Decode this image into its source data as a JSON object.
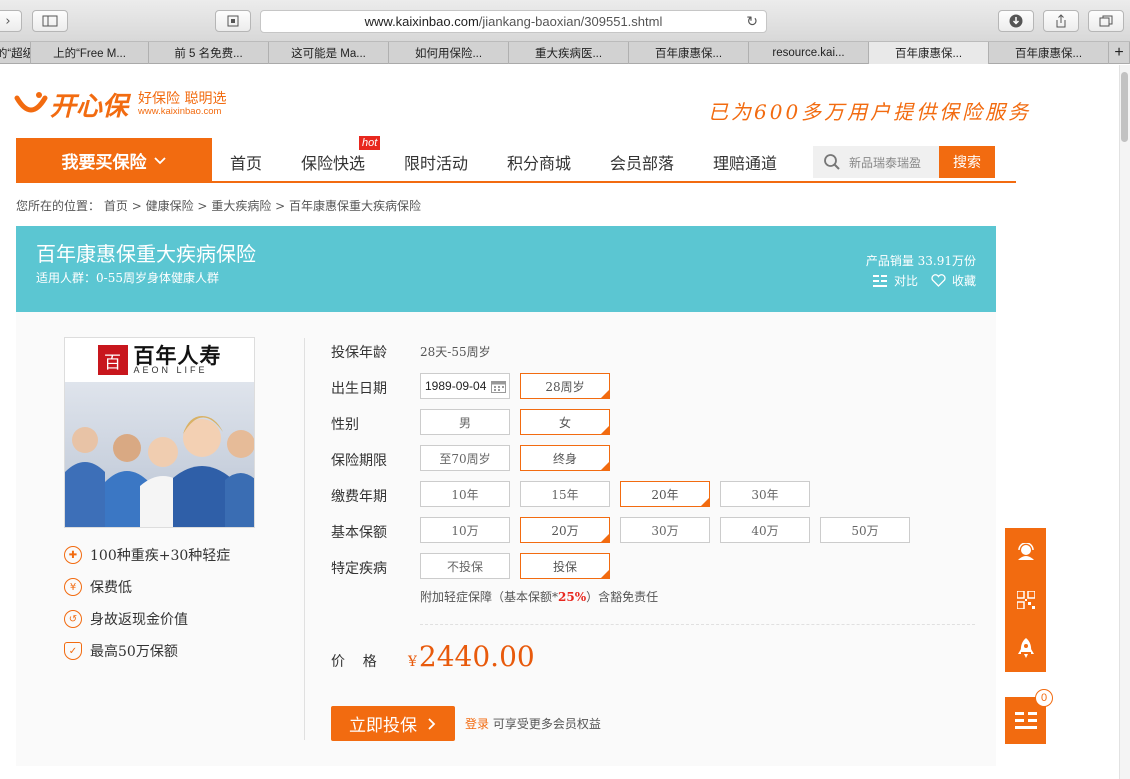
{
  "browser": {
    "url_domain": "www.kaixinbao.com",
    "url_path": "/jiankang-baoxian/309551.shtml",
    "tabs": [
      "的“超级",
      "上的“Free M...",
      "前 5 名免费...",
      "这可能是 Ma...",
      "如何用保险...",
      "重大疾病医...",
      "百年康惠保...",
      "resource.kai...",
      "百年康惠保...",
      "百年康惠保..."
    ],
    "active_tab_index": 8
  },
  "header": {
    "logo_text": "开心保",
    "logo_tagline1": "好保险 聪明选",
    "logo_tagline2": "www.kaixinbao.com",
    "slogan": "已为600多万用户提供保险服务"
  },
  "nav": {
    "buy_button": "我要买保险",
    "items": [
      "首页",
      "保险快选",
      "限时活动",
      "积分商城",
      "会员部落",
      "理赔通道"
    ],
    "hot_badge": "hot",
    "search_placeholder": "新品瑞泰瑞盈",
    "search_button": "搜索"
  },
  "breadcrumb": {
    "prefix": "您所在的位置：",
    "items": [
      "首页",
      "健康保险",
      "重大疾病险",
      "百年康惠保重大疾病保险"
    ],
    "separator": ">"
  },
  "banner": {
    "title": "百年康惠保重大疾病保险",
    "subtitle": "适用人群：0-55周岁身体健康人群",
    "sales": "产品销量 33.91万份",
    "compare": "对比",
    "favorite": "收藏"
  },
  "product": {
    "brand_cn": "百年人寿",
    "brand_en": "AEON LIFE",
    "features": [
      {
        "icon": "plus-icon",
        "text": "100种重疾+30种轻症"
      },
      {
        "icon": "yen-icon",
        "text": "保费低"
      },
      {
        "icon": "refund-icon",
        "text": "身故返现金价值"
      },
      {
        "icon": "shield-icon",
        "text": "最高50万保额"
      }
    ]
  },
  "form": {
    "age_label": "投保年龄",
    "age_value": "28天-55周岁",
    "birth_label": "出生日期",
    "birth_value": "1989-09-04",
    "birth_age": "28周岁",
    "gender_label": "性别",
    "gender_options": [
      "男",
      "女"
    ],
    "term_label": "保险期限",
    "term_options": [
      "至70周岁",
      "终身"
    ],
    "pay_label": "缴费年期",
    "pay_options": [
      "10年",
      "15年",
      "20年",
      "30年"
    ],
    "amount_label": "基本保额",
    "amount_options": [
      "10万",
      "20万",
      "30万",
      "40万",
      "50万"
    ],
    "disease_label": "特定疾病",
    "disease_options": [
      "不投保",
      "投保"
    ],
    "note_prefix": "附加轻症保障（基本保额*",
    "note_pct": "25%",
    "note_suffix": "）含豁免责任",
    "price_label": "价    格",
    "price_symbol": "¥",
    "price_value": "2440.00",
    "buy_button": "立即投保",
    "login_link": "登录",
    "login_suffix": "可享受更多会员权益"
  },
  "side": {
    "cart_count": "0"
  },
  "colors": {
    "brand": "#f26b10",
    "banner": "#5bc6d2",
    "price": "#e85a0c"
  }
}
